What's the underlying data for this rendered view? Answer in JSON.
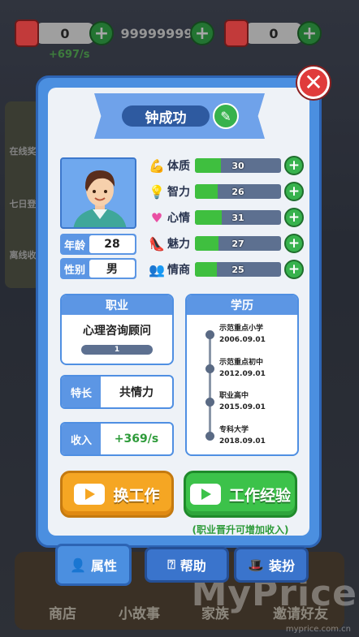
{
  "top_bar": {
    "resource_1_value": "0",
    "resource_1_rate": "+697/s",
    "resource_2_value": "99999999",
    "resource_3_value": "0"
  },
  "sidebar_left": [
    "在线奖",
    "七日登",
    "离线收"
  ],
  "bottom_nav": [
    "商店",
    "小故事",
    "家族",
    "邀请好友"
  ],
  "watermark": {
    "brand": "MyPrice",
    "url": "myprice.com.cn"
  },
  "profile": {
    "name": "钟成功",
    "age_label": "年龄",
    "age_value": "28",
    "gender_label": "性别",
    "gender_value": "男"
  },
  "stats": [
    {
      "label": "体质",
      "value": "30",
      "fill": 0.3,
      "icon": "muscle-icon"
    },
    {
      "label": "智力",
      "value": "26",
      "fill": 0.26,
      "icon": "lightbulb-icon"
    },
    {
      "label": "心情",
      "value": "31",
      "fill": 0.31,
      "icon": "heart-icon"
    },
    {
      "label": "魅力",
      "value": "27",
      "fill": 0.27,
      "icon": "high-heel-icon"
    },
    {
      "label": "情商",
      "value": "25",
      "fill": 0.25,
      "icon": "people-icon"
    }
  ],
  "job": {
    "title": "职业",
    "name": "心理咨询顾问",
    "level": "1"
  },
  "specialty": {
    "label": "特长",
    "value": "共情力"
  },
  "income": {
    "label": "收入",
    "value": "+369/s"
  },
  "education": {
    "title": "学历",
    "items": [
      {
        "school": "示范重点小学",
        "date": "2006.09.01"
      },
      {
        "school": "示范重点初中",
        "date": "2012.09.01"
      },
      {
        "school": "职业高中",
        "date": "2015.09.01"
      },
      {
        "school": "专科大学",
        "date": "2018.09.01"
      }
    ]
  },
  "buttons": {
    "change_job": "换工作",
    "work_experience": "工作经验",
    "hint": "(职业晋升可增加收入)"
  },
  "tabs": {
    "attributes": "属性",
    "help": "帮助",
    "dress_up": "装扮"
  },
  "colors": {
    "dialog_blue": "#4b8fe0",
    "bar_green": "#3fbf3f",
    "button_orange": "#f5a623",
    "button_green": "#3cc24a",
    "close_red": "#e03b3b"
  }
}
